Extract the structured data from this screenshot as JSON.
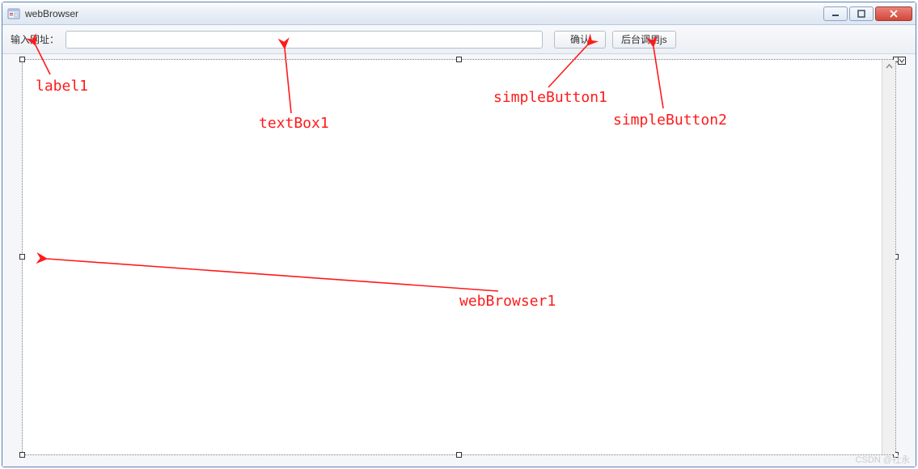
{
  "window": {
    "title": "webBrowser"
  },
  "toolbar": {
    "label": "输入网址：",
    "url_value": "",
    "confirm_label": "确认",
    "calljs_label": "后台调用js"
  },
  "annotations": {
    "label1": "label1",
    "textBox1": "textBox1",
    "simpleButton1": "simpleButton1",
    "simpleButton2": "simpleButton2",
    "webBrowser1": "webBrowser1"
  },
  "watermark": "CSDN @社永"
}
